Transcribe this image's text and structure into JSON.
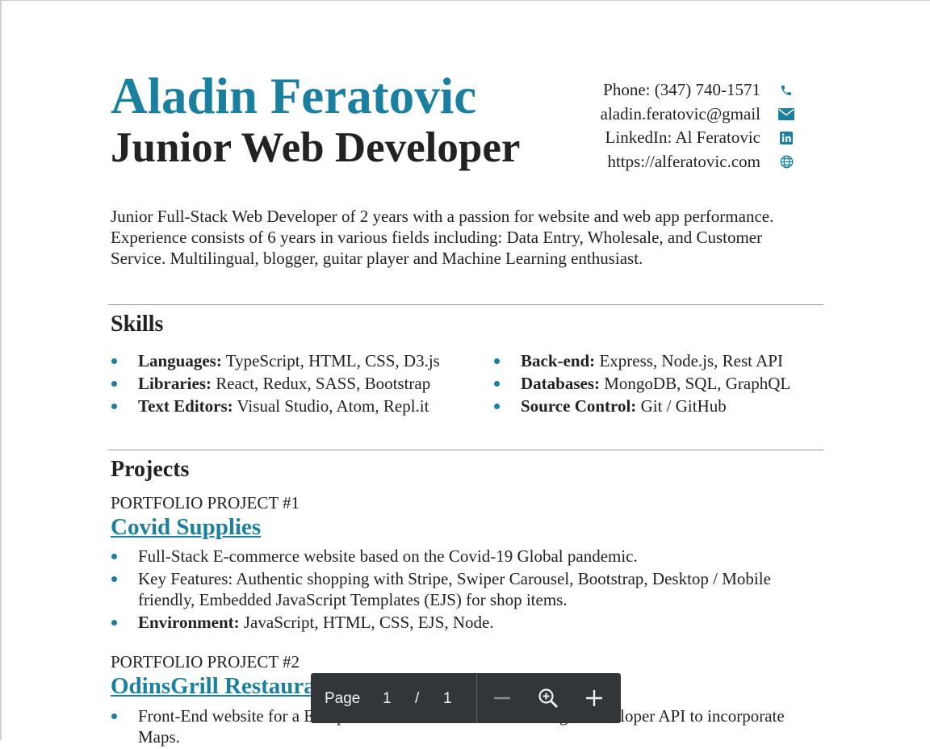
{
  "header": {
    "name": "Aladin Feratovic",
    "role": "Junior Web Developer"
  },
  "contact": [
    {
      "text": "Phone: (347) 740-1571",
      "icon": "phone-icon"
    },
    {
      "text": "aladin.feratovic@gmail",
      "icon": "email-icon"
    },
    {
      "text": "LinkedIn: Al Feratovic",
      "icon": "linkedin-icon"
    },
    {
      "text": "https://alferatovic.com",
      "icon": "globe-icon"
    }
  ],
  "summary": "Junior Full-Stack Web Developer of 2 years with a passion for website and web app performance. Experience consists of 6 years in various fields including: Data Entry, Wholesale, and Customer Service. Multilingual, blogger, guitar player and Machine Learning enthusiast.",
  "skills": {
    "title": "Skills",
    "left": [
      {
        "label": "Languages:",
        "value": " TypeScript, HTML, CSS, D3.js"
      },
      {
        "label": "Libraries:",
        "value": " React, Redux, SASS, Bootstrap"
      },
      {
        "label": "Text Editors:",
        "value": " Visual Studio, Atom, Repl.it"
      }
    ],
    "right": [
      {
        "label": "Back-end:",
        "value": " Express, Node.js, Rest API"
      },
      {
        "label": "Databases:",
        "value": " MongoDB, SQL, GraphQL"
      },
      {
        "label": "Source Control:",
        "value": " Git / GitHub"
      }
    ]
  },
  "projects": {
    "title": "Projects",
    "items": [
      {
        "label": "PORTFOLIO PROJECT #1",
        "title": "Covid Supplies",
        "bullets": [
          {
            "label": "",
            "value": "Full-Stack E-commerce website based on the Covid-19 Global pandemic."
          },
          {
            "label": "",
            "value": "Key Features: Authentic shopping with Stripe, Swiper Carousel, Bootstrap, Desktop / Mobile friendly, Embedded JavaScript Templates (EJS) for shop items."
          },
          {
            "label": "Environment:",
            "value": " JavaScript, HTML, CSS, EJS, Node."
          }
        ]
      },
      {
        "label": "PORTFOLIO PROJECT #2",
        "title": "OdinsGrill Restaurant",
        "bullets": [
          {
            "label": "",
            "value": "Front-End website for a European restaurant. Utilizes the Google Developer API to incorporate Maps."
          }
        ]
      }
    ]
  },
  "viewer": {
    "page_label": "Page",
    "current_page": "1",
    "separator": "/",
    "total_pages": "1"
  },
  "colors": {
    "accent": "#1a80a0",
    "text": "#222222",
    "toolbar": "#323639"
  }
}
